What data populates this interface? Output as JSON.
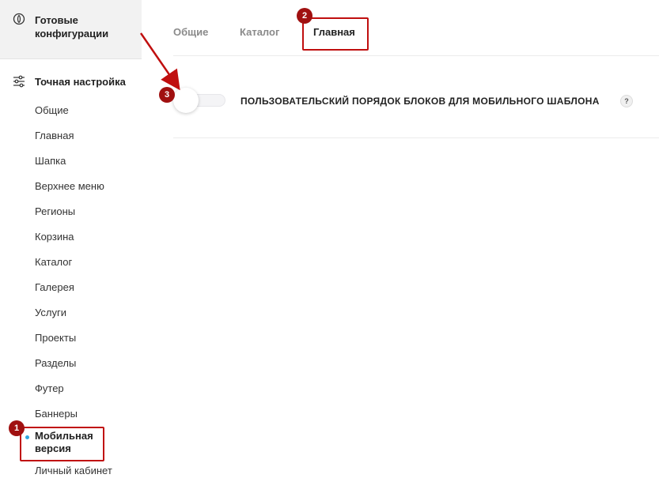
{
  "sidebar": {
    "ready_config": {
      "label": "Готовые конфигурации",
      "icon": "compass-icon"
    },
    "fine_tune": {
      "label": "Точная настройка",
      "icon": "sliders-icon"
    },
    "items": [
      {
        "label": "Общие"
      },
      {
        "label": "Главная"
      },
      {
        "label": "Шапка"
      },
      {
        "label": "Верхнее меню"
      },
      {
        "label": "Регионы"
      },
      {
        "label": "Корзина"
      },
      {
        "label": "Каталог"
      },
      {
        "label": "Галерея"
      },
      {
        "label": "Услуги"
      },
      {
        "label": "Проекты"
      },
      {
        "label": "Разделы"
      },
      {
        "label": "Футер"
      },
      {
        "label": "Баннеры"
      },
      {
        "label": "Мобильная версия",
        "active": true
      },
      {
        "label": "Личный кабинет"
      }
    ],
    "active_dot_color": "#2ea7e0"
  },
  "tabs": [
    {
      "label": "Общие"
    },
    {
      "label": "Каталог"
    },
    {
      "label": "Главная",
      "active": true
    }
  ],
  "setting": {
    "label": "ПОЛЬЗОВАТЕЛЬСКИЙ ПОРЯДОК БЛОКОВ ДЛЯ МОБИЛЬНОГО ШАБЛОНА",
    "toggle_on": false,
    "help_label": "?"
  },
  "annotations": {
    "badge_1": "1",
    "badge_2": "2",
    "badge_3": "3",
    "color": "#c00f0f"
  }
}
